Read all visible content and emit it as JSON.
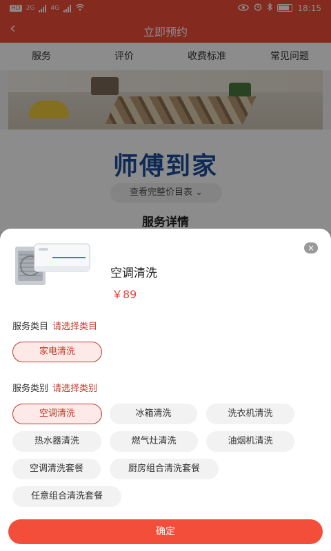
{
  "status_bar": {
    "left_icons": [
      "HD",
      "2G",
      "4G"
    ],
    "time": "18:15"
  },
  "navbar": {
    "back_glyph": "‹",
    "title": "立即预约"
  },
  "tabs": [
    "服务",
    "评价",
    "收费标准",
    "常见问题"
  ],
  "hero": {
    "title": "师傅到家",
    "price_link": "查看完整价目表 ⌄",
    "section_title": "服务详情"
  },
  "sheet": {
    "close_glyph": "×",
    "product": {
      "name": "空调清洗",
      "price": "￥89",
      "icon": "air-conditioner"
    },
    "category": {
      "label": "服务类目",
      "hint": "请选择类目",
      "options": [
        "家电清洗"
      ],
      "selected_index": 0
    },
    "type": {
      "label": "服务类别",
      "hint": "请选择类别",
      "options": [
        "空调清洗",
        "冰箱清洗",
        "洗衣机清洗",
        "热水器清洗",
        "燃气灶清洗",
        "油烟机清洗",
        "空调清洗套餐",
        "厨房组合清洗套餐",
        "任意组合清洗套餐"
      ],
      "selected_index": 0
    },
    "confirm_label": "确定"
  },
  "colors": {
    "brand": "#f24e3a",
    "accent": "#c0392b",
    "hero_title": "#1d4e9c"
  }
}
